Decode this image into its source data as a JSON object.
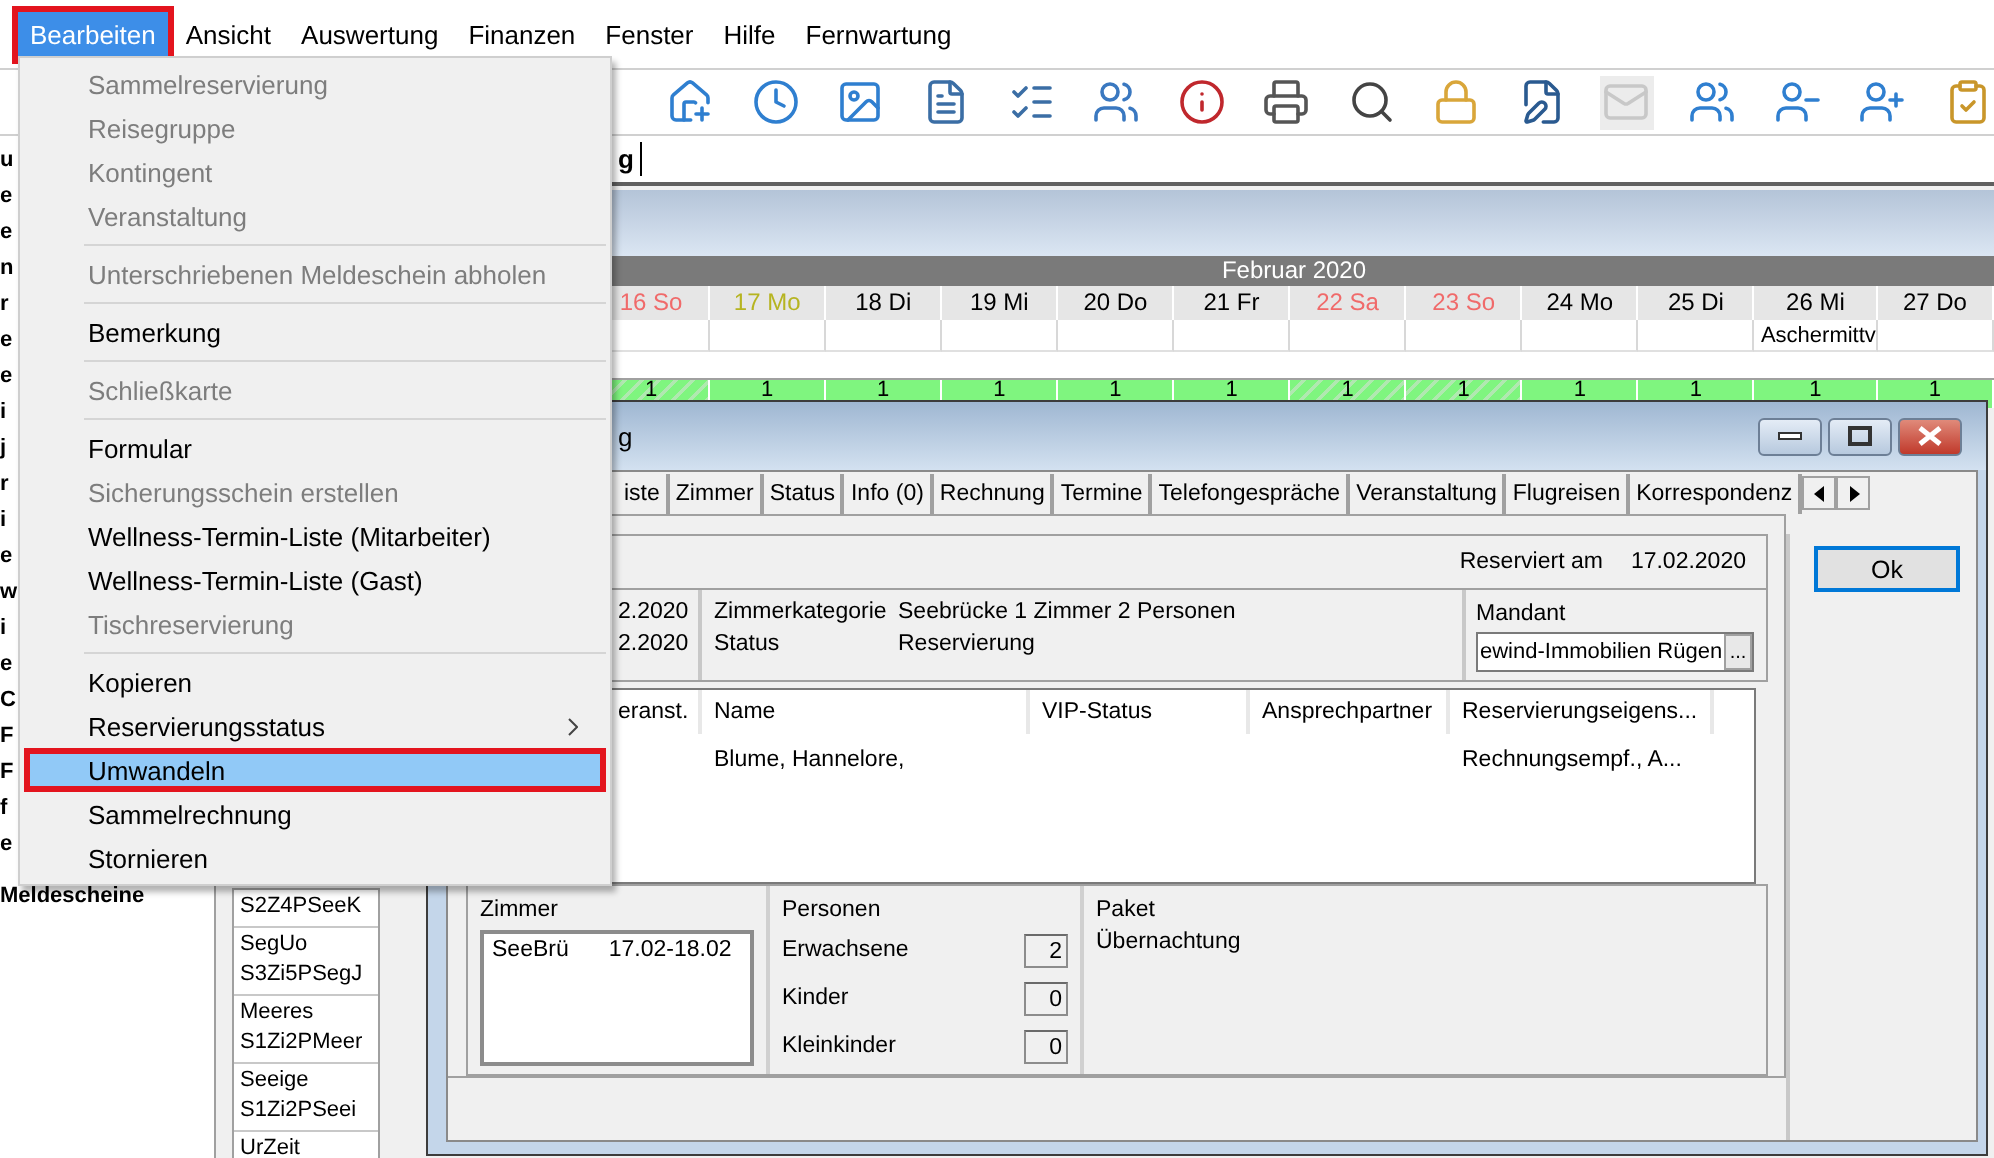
{
  "menubar": [
    {
      "label": "Bearbeiten",
      "selected": true
    },
    {
      "label": "Ansicht",
      "selected": false
    },
    {
      "label": "Auswertung",
      "selected": false
    },
    {
      "label": "Finanzen",
      "selected": false
    },
    {
      "label": "Fenster",
      "selected": false
    },
    {
      "label": "Hilfe",
      "selected": false
    },
    {
      "label": "Fernwartung",
      "selected": false
    }
  ],
  "toolbar": {
    "buttons": [
      {
        "disabled": false
      },
      {
        "disabled": false
      },
      {
        "disabled": false
      },
      {
        "disabled": false
      },
      {
        "disabled": false
      },
      {
        "disabled": false
      },
      {
        "disabled": false
      },
      {
        "disabled": false
      },
      {
        "disabled": false
      },
      {
        "disabled": false
      },
      {
        "disabled": false
      },
      {
        "disabled": true
      },
      {
        "disabled": false
      },
      {
        "disabled": false
      },
      {
        "disabled": false
      },
      {
        "disabled": false
      }
    ]
  },
  "search_bar": {
    "value": "g"
  },
  "sidebar": {
    "items": [
      "u",
      "e",
      "e",
      "n",
      "r",
      "e",
      "e",
      "i",
      "j",
      "r",
      "i",
      "e",
      "w",
      "i",
      "e",
      "C",
      "F",
      "F",
      "f",
      "e",
      "Meldescheine"
    ]
  },
  "calendar": {
    "month": "Februar 2020",
    "days": [
      {
        "label": "16 So",
        "kind": "weekend",
        "count": "1"
      },
      {
        "label": "17 Mo",
        "kind": "today",
        "count": "1"
      },
      {
        "label": "18 Di",
        "kind": "workday",
        "count": "1"
      },
      {
        "label": "19 Mi",
        "kind": "workday",
        "count": "1"
      },
      {
        "label": "20 Do",
        "kind": "workday",
        "count": "1"
      },
      {
        "label": "21 Fr",
        "kind": "workday",
        "count": "1"
      },
      {
        "label": "22 Sa",
        "kind": "weekend",
        "count": "1"
      },
      {
        "label": "23 So",
        "kind": "weekend",
        "count": "1"
      },
      {
        "label": "24 Mo",
        "kind": "workday",
        "count": "1"
      },
      {
        "label": "25 Di",
        "kind": "workday",
        "count": "1"
      },
      {
        "label": "26 Mi",
        "kind": "workday",
        "count": "1",
        "holiday": "Aschermittv"
      },
      {
        "label": "27 Do",
        "kind": "workday",
        "count": "1"
      }
    ]
  },
  "rooms": [
    {
      "lines": [
        "S2Z4PSeeK"
      ]
    },
    {
      "lines": [
        "SegUo",
        "S3Zi5PSegJ"
      ]
    },
    {
      "lines": [
        "Meeres",
        "S1Zi2PMeer"
      ]
    },
    {
      "lines": [
        "Seeige",
        "S1Zi2PSeei"
      ]
    },
    {
      "lines": [
        "UrZeit"
      ]
    }
  ],
  "dialog": {
    "title": "g",
    "tabs": [
      {
        "label": "iste",
        "selected": false
      },
      {
        "label": "Zimmer",
        "selected": false
      },
      {
        "label": "Status",
        "selected": false
      },
      {
        "label": "Info (0)",
        "selected": false
      },
      {
        "label": "Rechnung",
        "selected": false
      },
      {
        "label": "Termine",
        "selected": false
      },
      {
        "label": "Telefongespräche",
        "selected": false
      },
      {
        "label": "Veranstaltung",
        "selected": false
      },
      {
        "label": "Flugreisen",
        "selected": false
      },
      {
        "label": "Korrespondenz",
        "selected": false
      }
    ],
    "reserved_label": "Reserviert am",
    "reserved_date": "17.02.2020",
    "dates": [
      "2.2020",
      "2.2020"
    ],
    "fields": [
      {
        "label": "Zimmerkategorie",
        "value": "Seebrücke 1 Zimmer 2 Personen"
      },
      {
        "label": "Status",
        "value": "Reservierung"
      }
    ],
    "mandant": {
      "label": "Mandant",
      "value": "ewind-Immobilien Rügen",
      "button": "..."
    },
    "guests": {
      "columns": [
        "eranst.",
        "Name",
        "VIP-Status",
        "Ansprechpartner",
        "Reservierungseigens..."
      ],
      "rows": [
        {
          "name": "Blume, Hannelore,",
          "properties": "Rechnungsempf., A..."
        }
      ]
    },
    "room_box": {
      "label": "Zimmer",
      "entries": [
        {
          "room": "SeeBrü",
          "dates": "17.02-18.02"
        }
      ]
    },
    "persons": {
      "label": "Personen",
      "rows": [
        {
          "label": "Erwachsene",
          "value": "2"
        },
        {
          "label": "Kinder",
          "value": "0"
        },
        {
          "label": "Kleinkinder",
          "value": "0"
        }
      ]
    },
    "package": {
      "label": "Paket",
      "value": "Übernachtung"
    },
    "ok": "Ok"
  },
  "menu": {
    "items": [
      {
        "kind": "item",
        "label": "Sammelreservierung",
        "disabled": true,
        "selected": false,
        "submenu": false
      },
      {
        "kind": "item",
        "label": "Reisegruppe",
        "disabled": true,
        "selected": false,
        "submenu": false
      },
      {
        "kind": "item",
        "label": "Kontingent",
        "disabled": true,
        "selected": false,
        "submenu": false
      },
      {
        "kind": "item",
        "label": "Veranstaltung",
        "disabled": true,
        "selected": false,
        "submenu": false
      },
      {
        "kind": "separator"
      },
      {
        "kind": "item",
        "label": "Unterschriebenen Meldeschein abholen",
        "disabled": true,
        "selected": false,
        "submenu": false
      },
      {
        "kind": "separator"
      },
      {
        "kind": "item",
        "label": "Bemerkung",
        "disabled": false,
        "selected": false,
        "submenu": false
      },
      {
        "kind": "separator"
      },
      {
        "kind": "item",
        "label": "Schließkarte",
        "disabled": true,
        "selected": false,
        "submenu": false
      },
      {
        "kind": "separator"
      },
      {
        "kind": "item",
        "label": "Formular",
        "disabled": false,
        "selected": false,
        "submenu": false
      },
      {
        "kind": "item",
        "label": "Sicherungsschein erstellen",
        "disabled": true,
        "selected": false,
        "submenu": false
      },
      {
        "kind": "item",
        "label": "Wellness-Termin-Liste (Mitarbeiter)",
        "disabled": false,
        "selected": false,
        "submenu": false
      },
      {
        "kind": "item",
        "label": "Wellness-Termin-Liste (Gast)",
        "disabled": false,
        "selected": false,
        "submenu": false
      },
      {
        "kind": "item",
        "label": "Tischreservierung",
        "disabled": true,
        "selected": false,
        "submenu": false
      },
      {
        "kind": "separator"
      },
      {
        "kind": "item",
        "label": "Kopieren",
        "disabled": false,
        "selected": false,
        "submenu": false
      },
      {
        "kind": "item",
        "label": "Reservierungsstatus",
        "disabled": false,
        "selected": false,
        "submenu": true
      },
      {
        "kind": "item",
        "label": "Umwandeln",
        "disabled": false,
        "selected": true,
        "submenu": false
      },
      {
        "kind": "item",
        "label": "Sammelrechnung",
        "disabled": false,
        "selected": false,
        "submenu": false
      },
      {
        "kind": "item",
        "label": "Stornieren",
        "disabled": false,
        "selected": false,
        "submenu": false
      }
    ]
  }
}
